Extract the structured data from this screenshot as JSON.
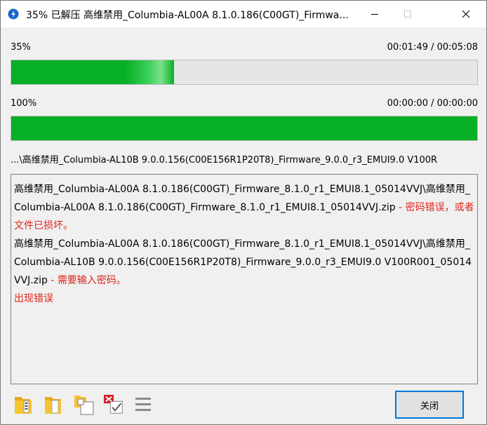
{
  "window": {
    "title": "35% 已解压 高维禁用_Columbia-AL00A 8.1.0.186(C00GT)_Firmwa...",
    "icons": {
      "app": "lightning-app-icon",
      "minimize": "minimize-icon",
      "maximize": "maximize-icon",
      "close": "close-icon"
    }
  },
  "progress": {
    "current": {
      "percent_label": "35%",
      "value": 0.35,
      "time": "00:01:49 / 00:05:08"
    },
    "total": {
      "percent_label": "100%",
      "value": 1.0,
      "time": "00:00:00 / 00:00:00"
    }
  },
  "current_path": "...\\高维禁用_Columbia-AL10B 9.0.0.156(C00E156R1P20T8)_Firmware_9.0.0_r3_EMUI9.0 V100R",
  "log": {
    "entries": [
      {
        "path": "高维禁用_Columbia-AL00A 8.1.0.186(C00GT)_Firmware_8.1.0_r1_EMUI8.1_05014VVJ\\高维禁用_Columbia-AL00A 8.1.0.186(C00GT)_Firmware_8.1.0_r1_EMUI8.1_05014VVJ.zip",
        "sep": " - ",
        "message": "密码错误，或者文件已损坏。"
      },
      {
        "path": "高维禁用_Columbia-AL00A 8.1.0.186(C00GT)_Firmware_8.1.0_r1_EMUI8.1_05014VVJ\\高维禁用_Columbia-AL10B 9.0.0.156(C00E156R1P20T8)_Firmware_9.0.0_r3_EMUI9.0 V100R001_05014VVJ.zip",
        "sep": " - ",
        "message": "需要输入密码。"
      }
    ],
    "summary": "出现错误"
  },
  "toolbar": {
    "icons": [
      "open-folder-icon",
      "folder-icon",
      "copy-icon",
      "checklist-icon",
      "menu-icon"
    ],
    "close_label": "关闭"
  },
  "colors": {
    "progress": "#06b025",
    "error": "#e0241a",
    "focus": "#0078d7"
  }
}
